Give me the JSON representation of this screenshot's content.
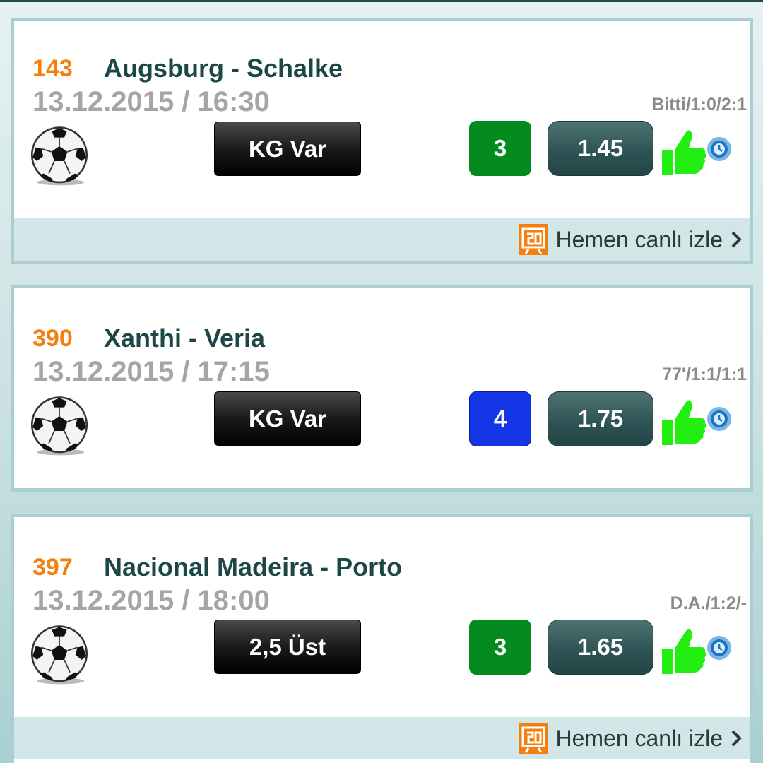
{
  "matches": [
    {
      "code": "143",
      "title": "Augsburg - Schalke",
      "datetime": "13.12.2015 / 16:30",
      "result": "Bitti/1:0/2:1",
      "bet": "KG Var",
      "count": "3",
      "count_color": "#048a1e",
      "odds": "1.45",
      "has_live": true,
      "live_label": "Hemen canlı izle"
    },
    {
      "code": "390",
      "title": "Xanthi - Veria",
      "datetime": "13.12.2015 / 17:15",
      "result": "77'/1:1/1:1",
      "bet": "KG Var",
      "count": "4",
      "count_color": "#1436e6",
      "odds": "1.75",
      "has_live": false
    },
    {
      "code": "397",
      "title": "Nacional Madeira - Porto",
      "datetime": "13.12.2015 / 18:00",
      "result": "D.A./1:2/-",
      "bet": "2,5 Üst",
      "count": "3",
      "count_color": "#048a1e",
      "odds": "1.65",
      "has_live": true,
      "live_label": "Hemen canlı izle"
    }
  ],
  "icons": {
    "sport": "soccer-ball-icon",
    "like": "thumbs-up-icon",
    "status": "clock-icon",
    "live": "live-stream-icon",
    "more": "chevron-right-icon"
  },
  "colors": {
    "code": "#f57f0e",
    "title": "#1c4747",
    "thumb": "#22ee11",
    "live_icon": "#f57f0e"
  }
}
